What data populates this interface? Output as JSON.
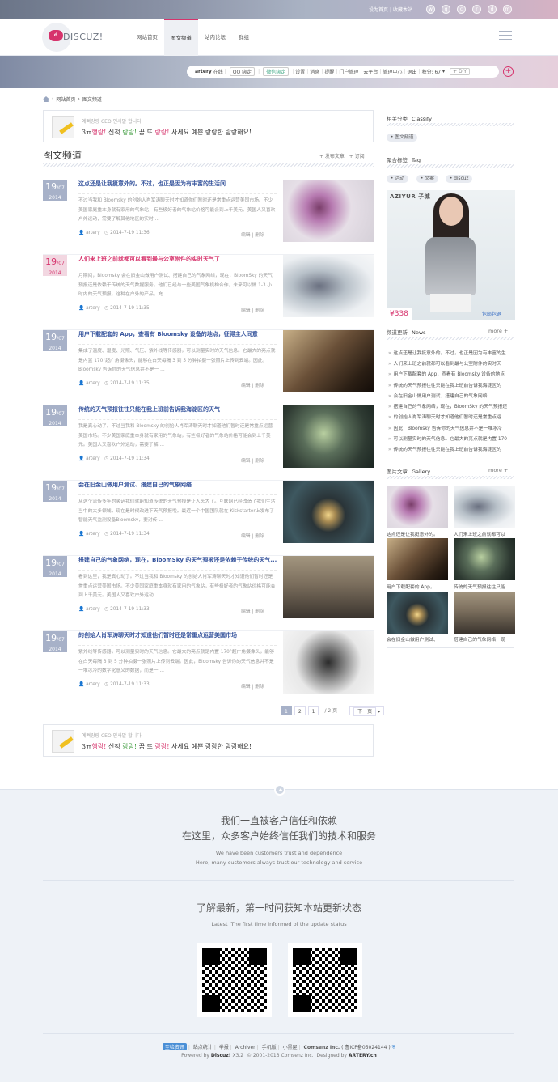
{
  "topbar": {
    "set_home": "设为首页",
    "bookmark": "收藏本站",
    "divider": "|",
    "social_icons": [
      "weibo-icon",
      "qq-icon",
      "wechat-icon",
      "renren-icon",
      "douban-icon",
      "mail-icon"
    ]
  },
  "header": {
    "logo_text": "DISCUZ!",
    "logo_badge": "d",
    "nav": [
      "网站首页",
      "图文频道",
      "站内论坛",
      "群组"
    ],
    "active_nav": "图文频道"
  },
  "userbar": {
    "username": "artery",
    "status": "在线",
    "qq": "QQ 绑定",
    "wechat": "微信绑定",
    "links": [
      "设置",
      "消息",
      "提醒",
      "门户管理",
      "云平台",
      "管理中心",
      "退出"
    ],
    "points": "积分: 67",
    "diy": "+ DIY"
  },
  "breadcrumb": {
    "home": "网站首页",
    "current": "图文频道"
  },
  "announcement": {
    "line1": "예뻐랑랑 CEO 인사말 합니다.",
    "line2a": "3ㅠ",
    "line2b": "행랑!",
    "line2c": " 신적 ",
    "line2d": "랑랑!",
    "line2e": " 꿈 또 ",
    "line2f": "랑랑!",
    "line2g": " 사세요 예쁜 랑랑한 랑랑해요!"
  },
  "section": {
    "title": "图文频道",
    "post": "+ 发布文章",
    "subscribe": "+ 订阅"
  },
  "articles": [
    {
      "day": "19",
      "month": "/07",
      "year": "2014",
      "title": "这点还是让我挺意外的。不过，也正是因为有丰富的生活间",
      "excerpt": "不过当我和 Bloomsky 的创始人肖军涛聊天时才知道你们暂时还是常重点运营美国市场。不少美国家庭重本身就有家用的气象站，有些极好者的气象站价格可能会到上千美元。美国人又喜欢户外运动，需要了解其他地区的实时 ...",
      "author": "artery",
      "time": "2014-7-19 11:36",
      "edit": "编辑",
      "del": "删除"
    },
    {
      "day": "19",
      "month": "/07",
      "year": "2014",
      "title": "人们来上班之前就都可以看到最与公室附件的实时天气了",
      "excerpt": "月期间，Bloomsky 会在旧金山做用户测试、搭建自己的气象网络，现在，BloomSky 的天气预报还是依赖于传统的天气数据服务，他们已经与一些美国气象机构合作，未来可以做 1-3 小时内的天气预报。这种在户外的产品，充 ...",
      "author": "artery",
      "time": "2014-7-19 11:35",
      "edit": "编辑",
      "del": "删除"
    },
    {
      "day": "19",
      "month": "/07",
      "year": "2014",
      "title": "用户下载配套的 App，查看有 Bloomsky 设备的地点，征得主人同意",
      "excerpt": "集成了温度、湿度、光照、气压、紫外线等传感器，可以测量实时的天气信息。它最大的亮点就是内置 170°超广角摄像头，能够在白天每隔 3 到 5 分钟拍摄一张照片上传到云端。因此，Bloomsky 告诉你的天气信息并不是一 ...",
      "author": "artery",
      "time": "2014-7-19 11:35",
      "edit": "编辑",
      "del": "删除"
    },
    {
      "day": "19",
      "month": "/07",
      "year": "2014",
      "title": "传统的天气预报往往只能在我上班前告诉我海淀区的天气",
      "excerpt": "我是真心动了。不过当我和 Bloomsky 的创始人肖军涛聊天时才知道他们暂时还是常重点运营美国市场。不少美国家庭重本身就有家用的气象站，有些极好者的气象站价格可能会到上千美元。美国人又喜欢户外运动，需要了解 ...",
      "author": "artery",
      "time": "2014-7-19 11:34",
      "edit": "编辑",
      "del": "删除"
    },
    {
      "day": "19",
      "month": "/07",
      "year": "2014",
      "title": "会在旧金山做用户测试、搭建自己的气象网络",
      "excerpt": "从这个流传多年的笑话我们就能知道传统的天气预报是让人头大了。互联网已经改造了我们生活当中的太多领域，现在是时候改进下天气预报啦。最近一个中国团队就在 Kickstarter上发布了智能天气监测设备Bloomsky，要对传 ...",
      "author": "artery",
      "time": "2014-7-19 11:34",
      "edit": "编辑",
      "del": "删除"
    },
    {
      "day": "19",
      "month": "/07",
      "year": "2014",
      "title": "搭建自己的气象网络，现在，BloomSky 的天气预报还是依赖于传统的天气...",
      "excerpt": "看到这里，我是真心动了。不过当我和 Bloomsky 的创始人肖军涛聊天时才知道他们暂时还是常重点运营美国市场。不少美国家庭重本身就有家用的气象站，有些极好者的气象站价格可能会到上千美元。美国人又喜欢户外运动 ...",
      "author": "artery",
      "time": "2014-7-19 11:33",
      "edit": "编辑",
      "del": "删除"
    },
    {
      "day": "19",
      "month": "/07",
      "year": "2014",
      "title": "的创始人肖军涛聊天时才知道他们暂时还是常重点运营美国市场",
      "excerpt": "紫外线等传感器，可以测量实时的天气信息。它最大的亮点就是内置 170°超广角摄像头，能够在白天每隔 3 到 5 分钟拍摄一张照片上传到云端。因此，Bloomsky 告诉你的天气信息并不是一堆冰冷的数字化意义的数据，而是一 ...",
      "author": "artery",
      "time": "2014-7-19 11:33",
      "edit": "编辑",
      "del": "删除"
    }
  ],
  "pager": {
    "current": "1",
    "next_num": "2",
    "input": "1",
    "total": "/ 2 页",
    "next": "下一页"
  },
  "sidebar": {
    "related": {
      "cn": "相关分类",
      "en": "Classify",
      "tag": "图文频道"
    },
    "tags": {
      "cn": "聚合标签",
      "en": "Tag",
      "items": [
        "活动",
        "文案",
        "discuz"
      ]
    },
    "ad": {
      "brand": "AZIYUR 子城",
      "price": "¥338",
      "stamp": "包邮包退"
    },
    "news": {
      "cn": "频道更新",
      "en": "News",
      "more": "more +",
      "items": [
        "这点还是让我挺意外的。不过，也正是因为有丰富的生",
        "人们来上班之前就都可以看到最与公室附件的实时天",
        "用户下载配套的 App，查看有 Bloomsky 设备的地点",
        "传统的天气预报往往只能在我上班前告诉我海淀区的",
        "会在旧金山做用户测试、搭建自己的气象网络",
        "搭建自己的气象网络，现在，BloomSky 的天气预报还",
        "的创始人肖军涛聊天时才知道他们暂时还是常重点运",
        "因此，Bloomsky 告诉你的天气信息并不是一堆冰冷",
        "可以测量实时的天气信息。它最大的亮点就是内置 170",
        "传统的天气预报往往只能在我上班前告诉我海淀区的"
      ]
    },
    "gallery": {
      "cn": "图片文章",
      "en": "Gallery",
      "more": "more +",
      "captions": [
        "这点还是让我挺意外的。",
        "人们来上班之前就都可以",
        "用户下载配套的 App，",
        "传统的天气预报往往只能",
        "会在旧金山做用户测试、",
        "搭建自己的气象网络，现"
      ]
    }
  },
  "footer_ann": {
    "line1": "예뻐랑랑 CEO 인사말 합니다."
  },
  "footer": {
    "cn1": "我们一直被客户信任和依赖",
    "cn2": "在这里，众多客户始终信任我们的技术和服务",
    "en1": "We have been customers trust and dependence",
    "en2": "Here, many customers always trust our technology and service",
    "cn3": "了解最新，第一时间获知本站更新状态",
    "en3": "Latest .The first time informed of the update status",
    "links": [
      "站点统计",
      "举报",
      "Archiver",
      "手机版",
      "小黑屋"
    ],
    "badge": "至检资讯",
    "company": "Comsenz Inc.",
    "icp": "( 鲁ICP备05024144 )",
    "power_prefix": "Powered by",
    "power_brand": "Discuz!",
    "power_version": "X3.2",
    "copyright": "© 2001-2013 Comsenz Inc.",
    "designed": "Designed by",
    "designer": "ARTERY.cn"
  }
}
